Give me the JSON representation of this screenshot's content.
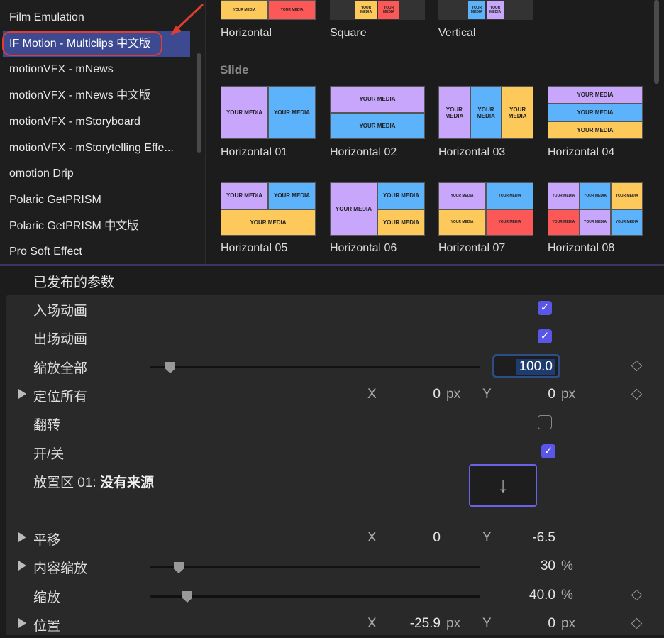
{
  "sidebar": {
    "items": [
      {
        "label": "Film Emulation"
      },
      {
        "label": "IF Motion - Multiclips 中文版",
        "selected": true
      },
      {
        "label": "motionVFX - mNews"
      },
      {
        "label": "motionVFX - mNews 中文版"
      },
      {
        "label": "motionVFX - mStoryboard"
      },
      {
        "label": "motionVFX - mStorytelling Effe..."
      },
      {
        "label": "omotion Drip"
      },
      {
        "label": "Polaric GetPRISM"
      },
      {
        "label": "Polaric GetPRISM 中文版"
      },
      {
        "label": "Pro Soft Effect"
      }
    ]
  },
  "browser": {
    "top_items": [
      {
        "label": "Horizontal"
      },
      {
        "label": "Square"
      },
      {
        "label": "Vertical"
      }
    ],
    "section": "Slide",
    "media_text": "YOUR MEDIA",
    "items": [
      {
        "label": "Horizontal 01"
      },
      {
        "label": "Horizontal 02"
      },
      {
        "label": "Horizontal 03"
      },
      {
        "label": "Horizontal 04"
      },
      {
        "label": "Horizontal 05"
      },
      {
        "label": "Horizontal 06"
      },
      {
        "label": "Horizontal 07"
      },
      {
        "label": "Horizontal 08"
      }
    ],
    "colors": {
      "purple": "#c7a6fb",
      "blue": "#5db3fb",
      "yellow": "#fdc95a",
      "red": "#fd5858"
    }
  },
  "params": {
    "header": "已发布的参数",
    "intro": {
      "label": "入场动画",
      "checked": true
    },
    "outro": {
      "label": "出场动画",
      "checked": true
    },
    "scale_all": {
      "label": "缩放全部",
      "value": "100.0"
    },
    "position_all": {
      "label": "定位所有",
      "x_label": "X",
      "x": "0",
      "x_unit": "px",
      "y_label": "Y",
      "y": "0",
      "y_unit": "px"
    },
    "flip": {
      "label": "翻转",
      "checked": false
    },
    "onoff": {
      "label": "开/关",
      "checked": true
    },
    "dropzone": {
      "label": "放置区 01:",
      "value": "没有来源",
      "icon": "arrow-down-icon"
    },
    "pan": {
      "label": "平移",
      "x_label": "X",
      "x": "0",
      "y_label": "Y",
      "y": "-6.5"
    },
    "content_scale": {
      "label": "内容缩放",
      "value": "30",
      "unit": "%",
      "fraction": 0.03
    },
    "scale": {
      "label": "缩放",
      "value": "40.0",
      "unit": "%",
      "fraction": 0.06
    },
    "position": {
      "label": "位置",
      "x_label": "X",
      "x": "-25.9",
      "x_unit": "px",
      "y_label": "Y",
      "y": "0",
      "y_unit": "px"
    }
  }
}
